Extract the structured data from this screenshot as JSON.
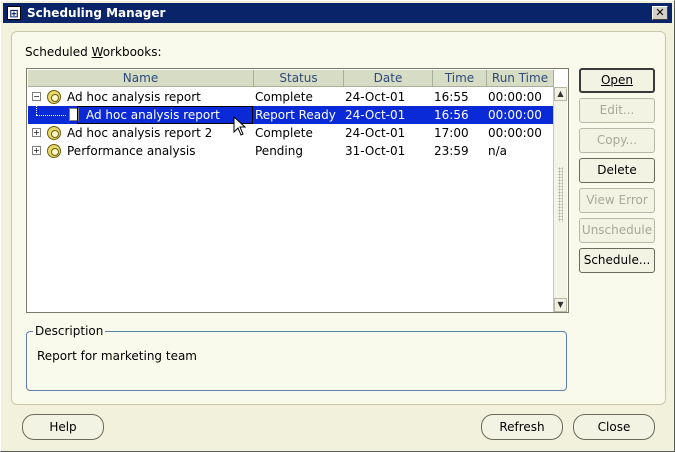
{
  "window": {
    "title": "Scheduling Manager",
    "close_glyph": "✕"
  },
  "panel": {
    "label_prefix": "Scheduled ",
    "label_underlined": "W",
    "label_suffix": "orkbooks:"
  },
  "table": {
    "columns": [
      "Name",
      "Status",
      "Date",
      "Time",
      "Run Time"
    ],
    "rows": [
      {
        "name": "Ad hoc analysis report",
        "status": "Complete",
        "date": "24-Oct-01",
        "time": "16:55",
        "run_time": "00:00:00",
        "level": 0,
        "expanded": true,
        "icon": "clock-icon"
      },
      {
        "name": "Ad hoc analysis report",
        "status": "Report Ready",
        "date": "24-Oct-01",
        "time": "16:56",
        "run_time": "00:00:00",
        "level": 1,
        "selected": true,
        "icon": "document-icon"
      },
      {
        "name": "Ad hoc analysis report 2",
        "status": "Complete",
        "date": "24-Oct-01",
        "time": "17:00",
        "run_time": "00:00:00",
        "level": 0,
        "expanded": false,
        "icon": "clock-icon"
      },
      {
        "name": "Performance analysis",
        "status": "Pending",
        "date": "31-Oct-01",
        "time": "23:59",
        "run_time": "n/a",
        "level": 0,
        "expanded": false,
        "icon": "clock-icon"
      }
    ]
  },
  "buttons": {
    "open": {
      "label": "Open",
      "enabled": true
    },
    "edit": {
      "label": "Edit...",
      "enabled": false
    },
    "copy": {
      "label": "Copy...",
      "enabled": false
    },
    "delete": {
      "label": "Delete",
      "enabled": true
    },
    "view_error": {
      "label": "View Error",
      "enabled": false
    },
    "unschedule": {
      "label": "Unschedule",
      "enabled": false
    },
    "schedule": {
      "label": "Schedule...",
      "enabled": true
    }
  },
  "description": {
    "legend": "Description",
    "text": "Report for marketing team"
  },
  "footer": {
    "help": "Help",
    "refresh": "Refresh",
    "close": "Close"
  },
  "colors": {
    "title_bar": "#0a246a",
    "selection": "#0a2ad8",
    "header_text": "#2d4a7a"
  }
}
